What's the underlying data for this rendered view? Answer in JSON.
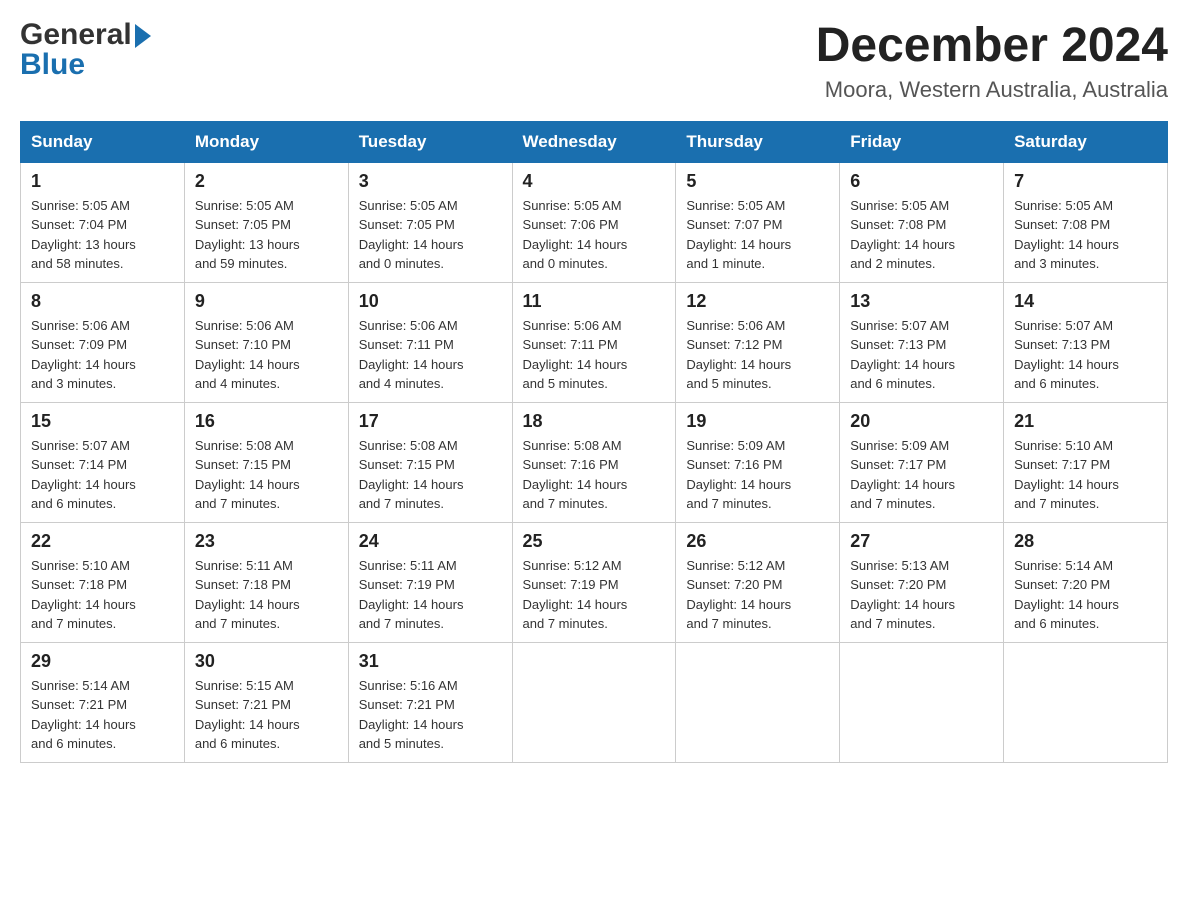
{
  "header": {
    "logo_general": "General",
    "logo_blue": "Blue",
    "month_title": "December 2024",
    "location": "Moora, Western Australia, Australia"
  },
  "days_of_week": [
    "Sunday",
    "Monday",
    "Tuesday",
    "Wednesday",
    "Thursday",
    "Friday",
    "Saturday"
  ],
  "weeks": [
    [
      {
        "day": "1",
        "sunrise": "5:05 AM",
        "sunset": "7:04 PM",
        "daylight": "13 hours and 58 minutes."
      },
      {
        "day": "2",
        "sunrise": "5:05 AM",
        "sunset": "7:05 PM",
        "daylight": "13 hours and 59 minutes."
      },
      {
        "day": "3",
        "sunrise": "5:05 AM",
        "sunset": "7:05 PM",
        "daylight": "14 hours and 0 minutes."
      },
      {
        "day": "4",
        "sunrise": "5:05 AM",
        "sunset": "7:06 PM",
        "daylight": "14 hours and 0 minutes."
      },
      {
        "day": "5",
        "sunrise": "5:05 AM",
        "sunset": "7:07 PM",
        "daylight": "14 hours and 1 minute."
      },
      {
        "day": "6",
        "sunrise": "5:05 AM",
        "sunset": "7:08 PM",
        "daylight": "14 hours and 2 minutes."
      },
      {
        "day": "7",
        "sunrise": "5:05 AM",
        "sunset": "7:08 PM",
        "daylight": "14 hours and 3 minutes."
      }
    ],
    [
      {
        "day": "8",
        "sunrise": "5:06 AM",
        "sunset": "7:09 PM",
        "daylight": "14 hours and 3 minutes."
      },
      {
        "day": "9",
        "sunrise": "5:06 AM",
        "sunset": "7:10 PM",
        "daylight": "14 hours and 4 minutes."
      },
      {
        "day": "10",
        "sunrise": "5:06 AM",
        "sunset": "7:11 PM",
        "daylight": "14 hours and 4 minutes."
      },
      {
        "day": "11",
        "sunrise": "5:06 AM",
        "sunset": "7:11 PM",
        "daylight": "14 hours and 5 minutes."
      },
      {
        "day": "12",
        "sunrise": "5:06 AM",
        "sunset": "7:12 PM",
        "daylight": "14 hours and 5 minutes."
      },
      {
        "day": "13",
        "sunrise": "5:07 AM",
        "sunset": "7:13 PM",
        "daylight": "14 hours and 6 minutes."
      },
      {
        "day": "14",
        "sunrise": "5:07 AM",
        "sunset": "7:13 PM",
        "daylight": "14 hours and 6 minutes."
      }
    ],
    [
      {
        "day": "15",
        "sunrise": "5:07 AM",
        "sunset": "7:14 PM",
        "daylight": "14 hours and 6 minutes."
      },
      {
        "day": "16",
        "sunrise": "5:08 AM",
        "sunset": "7:15 PM",
        "daylight": "14 hours and 7 minutes."
      },
      {
        "day": "17",
        "sunrise": "5:08 AM",
        "sunset": "7:15 PM",
        "daylight": "14 hours and 7 minutes."
      },
      {
        "day": "18",
        "sunrise": "5:08 AM",
        "sunset": "7:16 PM",
        "daylight": "14 hours and 7 minutes."
      },
      {
        "day": "19",
        "sunrise": "5:09 AM",
        "sunset": "7:16 PM",
        "daylight": "14 hours and 7 minutes."
      },
      {
        "day": "20",
        "sunrise": "5:09 AM",
        "sunset": "7:17 PM",
        "daylight": "14 hours and 7 minutes."
      },
      {
        "day": "21",
        "sunrise": "5:10 AM",
        "sunset": "7:17 PM",
        "daylight": "14 hours and 7 minutes."
      }
    ],
    [
      {
        "day": "22",
        "sunrise": "5:10 AM",
        "sunset": "7:18 PM",
        "daylight": "14 hours and 7 minutes."
      },
      {
        "day": "23",
        "sunrise": "5:11 AM",
        "sunset": "7:18 PM",
        "daylight": "14 hours and 7 minutes."
      },
      {
        "day": "24",
        "sunrise": "5:11 AM",
        "sunset": "7:19 PM",
        "daylight": "14 hours and 7 minutes."
      },
      {
        "day": "25",
        "sunrise": "5:12 AM",
        "sunset": "7:19 PM",
        "daylight": "14 hours and 7 minutes."
      },
      {
        "day": "26",
        "sunrise": "5:12 AM",
        "sunset": "7:20 PM",
        "daylight": "14 hours and 7 minutes."
      },
      {
        "day": "27",
        "sunrise": "5:13 AM",
        "sunset": "7:20 PM",
        "daylight": "14 hours and 7 minutes."
      },
      {
        "day": "28",
        "sunrise": "5:14 AM",
        "sunset": "7:20 PM",
        "daylight": "14 hours and 6 minutes."
      }
    ],
    [
      {
        "day": "29",
        "sunrise": "5:14 AM",
        "sunset": "7:21 PM",
        "daylight": "14 hours and 6 minutes."
      },
      {
        "day": "30",
        "sunrise": "5:15 AM",
        "sunset": "7:21 PM",
        "daylight": "14 hours and 6 minutes."
      },
      {
        "day": "31",
        "sunrise": "5:16 AM",
        "sunset": "7:21 PM",
        "daylight": "14 hours and 5 minutes."
      },
      null,
      null,
      null,
      null
    ]
  ],
  "labels": {
    "sunrise": "Sunrise:",
    "sunset": "Sunset:",
    "daylight": "Daylight:"
  },
  "accent_color": "#1a6faf"
}
